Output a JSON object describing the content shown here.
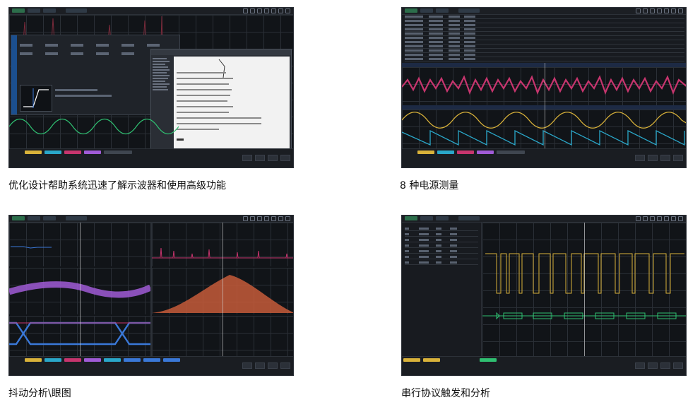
{
  "panels": [
    {
      "caption": "优化设计帮助系统迅速了解示波器和使用高级功能"
    },
    {
      "caption": "8  种电源测量"
    },
    {
      "caption": "抖动分析\\眼图"
    },
    {
      "caption": "串行协议触发和分析"
    }
  ],
  "colors": {
    "background": "#111418",
    "trace_yellow": "#d9b23a",
    "trace_cyan": "#2aa7c9",
    "trace_magenta": "#c7356e",
    "trace_purple": "#a05bd6",
    "trace_orange": "#d8603e",
    "trace_green": "#2fbf71",
    "trace_blue": "#3a78d8"
  }
}
